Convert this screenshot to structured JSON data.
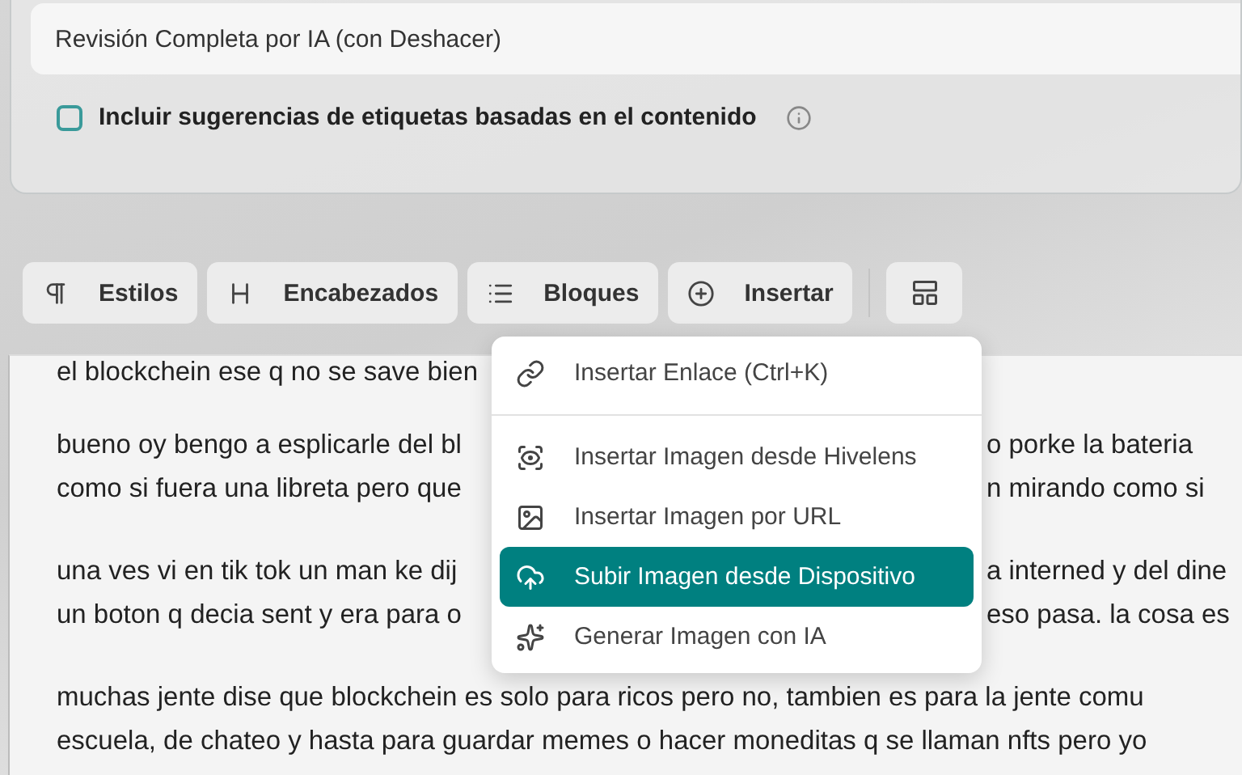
{
  "review_panel": {
    "mode_field": {
      "value": "Revisión Completa por IA (con Deshacer)"
    },
    "tag_option": {
      "label": "Incluir sugerencias de etiquetas basadas en el contenido",
      "checked": false
    }
  },
  "toolbar": {
    "buttons": [
      {
        "label": "Estilos"
      },
      {
        "label": "Encabezados"
      },
      {
        "label": "Bloques"
      },
      {
        "label": "Insertar"
      }
    ]
  },
  "editor": {
    "lines": [
      {
        "kind": "cut",
        "left": "el blockchein ese q no se save bien"
      },
      {
        "kind": "gap"
      },
      {
        "kind": "split",
        "left": "bueno oy bengo a esplicarle del bl",
        "right": "o porke la bateria"
      },
      {
        "kind": "split",
        "left": "como si fuera una libreta pero que",
        "right": "n mirando como si"
      },
      {
        "kind": "gap"
      },
      {
        "kind": "split",
        "left": "una ves vi en tik tok un man ke dij",
        "right": "a interned y del dine"
      },
      {
        "kind": "split",
        "left": "un boton q decia sent y era para o",
        "right": "eso pasa. la cosa es"
      },
      {
        "kind": "gap"
      },
      {
        "kind": "full",
        "left": "muchas jente dise que blockchein es solo para ricos pero no, tambien es para la jente comu"
      },
      {
        "kind": "full",
        "left": "escuela, de chateo y hasta para guardar memes o hacer moneditas q se llaman nfts pero yo"
      }
    ]
  },
  "insert_menu": {
    "items": [
      {
        "kind": "item",
        "label": "Insertar Enlace (Ctrl+K)",
        "selected": false
      },
      {
        "kind": "divider"
      },
      {
        "kind": "item",
        "label": "Insertar Imagen desde Hivelens",
        "selected": false
      },
      {
        "kind": "item",
        "label": "Insertar Imagen por URL",
        "selected": false
      },
      {
        "kind": "item",
        "label": "Subir Imagen desde Dispositivo",
        "selected": true
      },
      {
        "kind": "item",
        "label": "Generar Imagen con IA",
        "selected": false
      }
    ]
  }
}
